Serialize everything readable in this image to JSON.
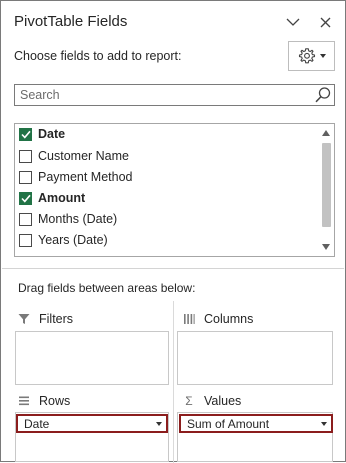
{
  "header": {
    "title": "PivotTable Fields"
  },
  "chooser": {
    "label": "Choose fields to add to report:"
  },
  "search": {
    "placeholder": "Search",
    "value": ""
  },
  "fields": [
    {
      "label": "Date",
      "checked": true
    },
    {
      "label": "Customer Name",
      "checked": false
    },
    {
      "label": "Payment Method",
      "checked": false
    },
    {
      "label": "Amount",
      "checked": true
    },
    {
      "label": "Months (Date)",
      "checked": false
    },
    {
      "label": "Years (Date)",
      "checked": false
    }
  ],
  "areas": {
    "instruction": "Drag fields between areas below:",
    "filters": {
      "label": "Filters",
      "icon": "filter-icon"
    },
    "columns": {
      "label": "Columns",
      "icon": "columns-icon"
    },
    "rows": {
      "label": "Rows",
      "icon": "rows-icon",
      "item": "Date"
    },
    "values": {
      "label": "Values",
      "icon": "sigma-icon",
      "symbol": "Σ",
      "item": "Sum of Amount"
    }
  },
  "colors": {
    "check_green": "#217346",
    "pill_border": "#8b1d1d"
  }
}
